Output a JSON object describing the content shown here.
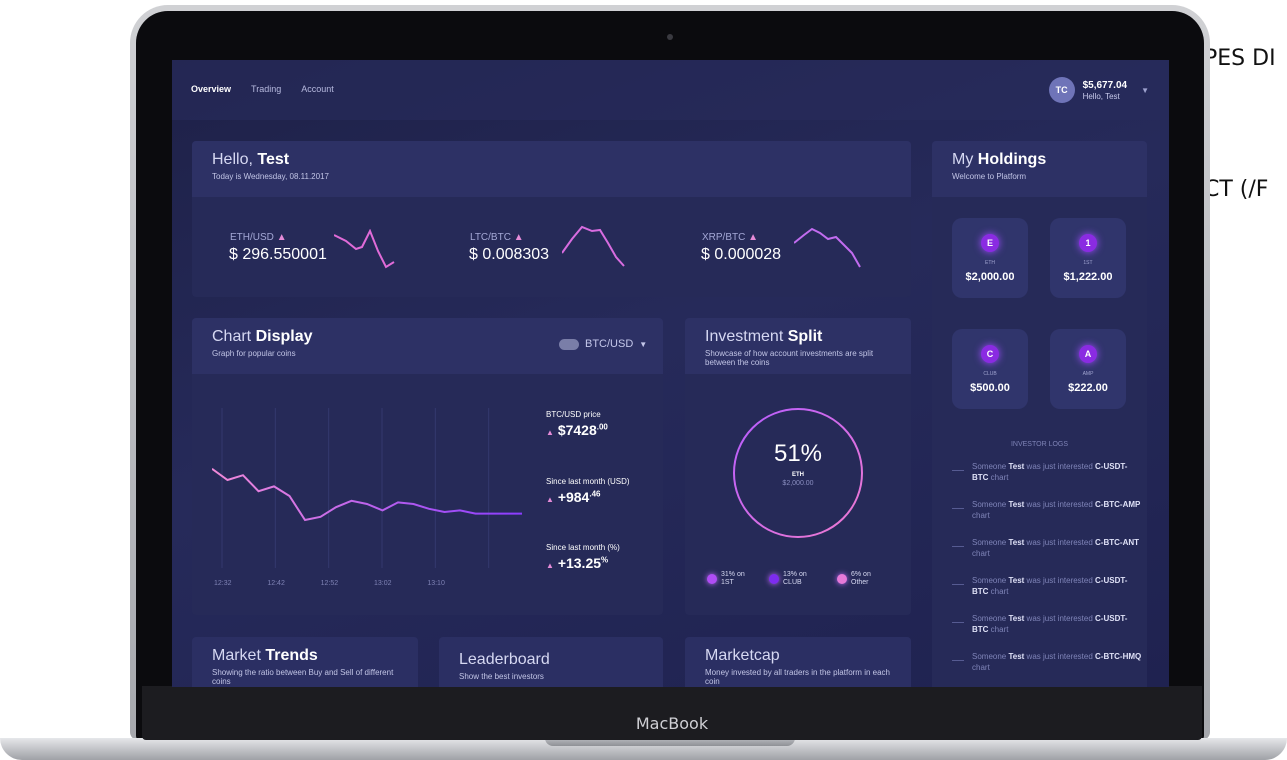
{
  "cutoff_text": [
    "PES DI",
    "CT (/F"
  ],
  "laptop_brand": "MacBook",
  "nav": {
    "items": [
      "Overview",
      "Trading",
      "Account"
    ]
  },
  "user": {
    "initials": "TC",
    "balance": "$5,677.04",
    "greeting": "Hello, Test"
  },
  "hello_card": {
    "title_prefix": "Hello, ",
    "title_name": "Test",
    "subtitle": "Today is Wednesday, 08.11.2017"
  },
  "tickers": [
    {
      "pair": "ETH/USD",
      "price": "$ 296.550001"
    },
    {
      "pair": "LTC/BTC",
      "price": "$ 0.008303"
    },
    {
      "pair": "XRP/BTC",
      "price": "$ 0.000028"
    }
  ],
  "chart_card": {
    "title_prefix": "Chart ",
    "title_bold": "Display",
    "subtitle": "Graph for popular coins",
    "selector": "BTC/USD",
    "stats": [
      {
        "label": "BTC/USD price",
        "value": "$7428",
        "sup": ".00"
      },
      {
        "label": "Since last month (USD)",
        "value": "+984",
        "sup": ".46"
      },
      {
        "label": "Since last month (%)",
        "value": "+13.25",
        "sup": "%"
      }
    ]
  },
  "chart_data": {
    "type": "line",
    "x": [
      "12:32",
      "12:42",
      "12:52",
      "13:02",
      "13:10"
    ],
    "series": [
      {
        "values": [
          62,
          55,
          58,
          48,
          51,
          45,
          30,
          32,
          38,
          42,
          40,
          36,
          41,
          40,
          37,
          35,
          36,
          34,
          34,
          34,
          34
        ]
      }
    ],
    "xlabel": "",
    "ylabel": "",
    "ylim": [
      0,
      100
    ],
    "grid": true
  },
  "split_card": {
    "title_prefix": "Investment ",
    "title_bold": "Split",
    "subtitle": "Showcase of how account investments are split between the coins",
    "percent": "51%",
    "coin": "ETH",
    "amount": "$2,000.00",
    "legend": [
      {
        "pct": "31% on",
        "name": "1ST"
      },
      {
        "pct": "13% on",
        "name": "CLUB"
      },
      {
        "pct": "6% on",
        "name": "Other"
      }
    ]
  },
  "holdings": {
    "title_prefix": "My ",
    "title_bold": "Holdings",
    "subtitle": "Welcome to Platform",
    "items": [
      {
        "icon": "E",
        "name": "ETH",
        "amount": "$2,000.00"
      },
      {
        "icon": "1",
        "name": "1ST",
        "amount": "$1,222.00"
      },
      {
        "icon": "C",
        "name": "CLUB",
        "amount": "$500.00"
      },
      {
        "icon": "A",
        "name": "AMP",
        "amount": "$222.00"
      }
    ],
    "logs_title": "INVESTOR LOGS",
    "logs": [
      {
        "pre": "Someone ",
        "who": "Test",
        "mid": " was just interested ",
        "pair": "C-USDT-BTC",
        "post": " chart"
      },
      {
        "pre": "Someone ",
        "who": "Test",
        "mid": " was just interested ",
        "pair": "C-BTC-AMP",
        "post": " chart"
      },
      {
        "pre": "Someone ",
        "who": "Test",
        "mid": " was just interested ",
        "pair": "C-BTC-ANT",
        "post": " chart"
      },
      {
        "pre": "Someone ",
        "who": "Test",
        "mid": " was just interested ",
        "pair": "C-USDT-BTC",
        "post": " chart"
      },
      {
        "pre": "Someone ",
        "who": "Test",
        "mid": " was just interested ",
        "pair": "C-USDT-BTC",
        "post": " chart"
      },
      {
        "pre": "Someone ",
        "who": "Test",
        "mid": " was just interested ",
        "pair": "C-BTC-HMQ",
        "post": " chart"
      }
    ]
  },
  "bottom_cards": [
    {
      "title_prefix": "Market ",
      "title_bold": "Trends",
      "subtitle": "Showing the ratio between Buy and Sell of different coins"
    },
    {
      "title_prefix": "Leaderboard",
      "title_bold": "",
      "subtitle": "Show the best investors"
    },
    {
      "title_prefix": "Marketcap",
      "title_bold": "",
      "subtitle": "Money invested by all traders in the platform in each coin"
    }
  ],
  "colors": {
    "accent": "#b04df5",
    "up": "#e58bd8",
    "background": "#232653"
  }
}
